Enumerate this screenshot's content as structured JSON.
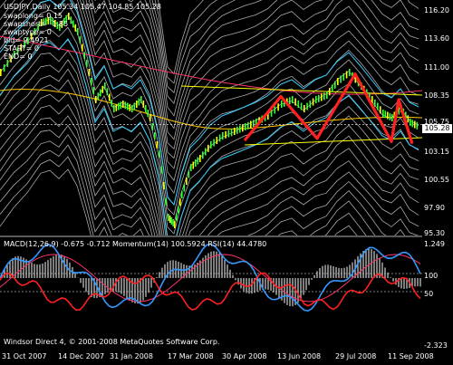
{
  "chart": {
    "title": "USDJPY,Daily  105.34 105.47 104.85 105.28",
    "params": [
      "swaplong= 0.15",
      "swapshort= -1.85",
      "swaptype= 0",
      "bid= 9.4921",
      "START= 0",
      "END= 0"
    ],
    "current_price": "105.28",
    "price_labels": [
      "116.20",
      "113.60",
      "111.00",
      "108.35",
      "105.75",
      "103.15",
      "100.55",
      "97.90",
      "95.30"
    ],
    "indicator_title": "MACD(12,26,9) -0.675 -0.712  Momentum(14) 100.5924  RSI(14) 44.4780",
    "indicator_labels": [
      "1.249",
      "100",
      "50",
      "-2.323"
    ],
    "copyright": "Windsor Direct 4, © 2001-2008 MetaQuotes Software Corp.",
    "dates": [
      "31 Oct 2007",
      "14 Dec 2007",
      "31 Jan 2008",
      "17 Mar 2008",
      "30 Apr 2008",
      "13 Jun 2008",
      "29 Jul 2008",
      "11 Sep 2008"
    ],
    "colors": {
      "background": "#000000",
      "candle_up": "#33ff33",
      "candle_down": "#ffff00",
      "band": "#c8c8c8",
      "pattern": "#ff2020",
      "ma_cyan": "#33ccff",
      "ma_red": "#ff3366",
      "macd": "#3399ff",
      "rsi": "#ff2020"
    },
    "price_range": [
      95.3,
      116.2
    ],
    "pattern_points": [
      {
        "date_index": 0,
        "price": 103.8
      },
      {
        "date_index": 1,
        "price": 107.9
      },
      {
        "date_index": 2,
        "price": 104.0
      },
      {
        "date_index": 3,
        "price": 110.0
      },
      {
        "date_index": 4,
        "price": 103.7
      },
      {
        "date_index": 5,
        "price": 107.6
      },
      {
        "date_index": 6,
        "price": 103.5
      }
    ]
  }
}
